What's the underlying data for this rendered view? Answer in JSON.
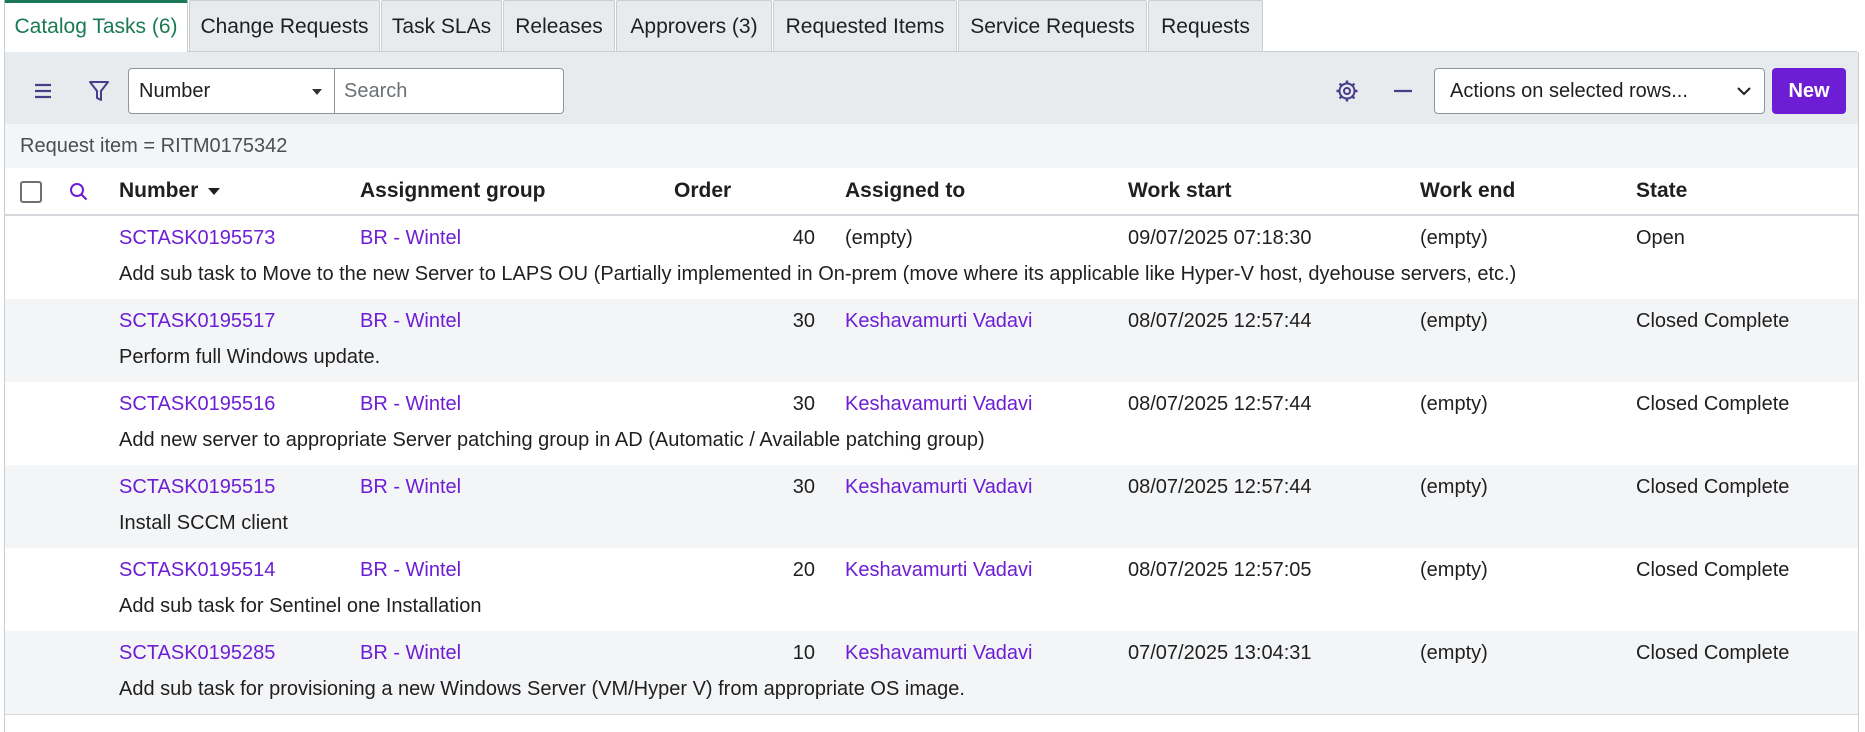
{
  "tabs": [
    {
      "label": "Catalog Tasks (6)",
      "active": true
    },
    {
      "label": "Change Requests"
    },
    {
      "label": "Task SLAs"
    },
    {
      "label": "Releases"
    },
    {
      "label": "Approvers (3)"
    },
    {
      "label": "Requested Items"
    },
    {
      "label": "Service Requests"
    },
    {
      "label": "Requests"
    }
  ],
  "toolbar": {
    "menu_icon": "hamburger-icon",
    "filter_icon": "funnel-icon",
    "field_select": "Number",
    "search_placeholder": "Search",
    "gear_icon": "gear-icon",
    "collapse_icon": "minus-icon",
    "actions_select": "Actions on selected rows...",
    "new_label": "New"
  },
  "filter_text": "Request item = RITM0175342",
  "columns": {
    "number": "Number",
    "assignment_group": "Assignment group",
    "order": "Order",
    "assigned_to": "Assigned to",
    "work_start": "Work start",
    "work_end": "Work end",
    "state": "State"
  },
  "rows": [
    {
      "number": "SCTASK0195573",
      "group": "BR - Wintel",
      "order": "40",
      "assigned_to": "(empty)",
      "assigned_link": false,
      "work_start": "09/07/2025 07:18:30",
      "work_end": "(empty)",
      "state": "Open",
      "description": "Add sub task to Move to the new Server to LAPS OU (Partially implemented in On-prem (move where its applicable like Hyper-V host, dyehouse servers, etc.)"
    },
    {
      "number": "SCTASK0195517",
      "group": "BR - Wintel",
      "order": "30",
      "assigned_to": "Keshavamurti Vadavi",
      "assigned_link": true,
      "work_start": "08/07/2025 12:57:44",
      "work_end": "(empty)",
      "state": "Closed Complete",
      "description": "Perform full Windows update."
    },
    {
      "number": "SCTASK0195516",
      "group": "BR - Wintel",
      "order": "30",
      "assigned_to": "Keshavamurti Vadavi",
      "assigned_link": true,
      "work_start": "08/07/2025 12:57:44",
      "work_end": "(empty)",
      "state": "Closed Complete",
      "description": "Add new server to appropriate Server patching group in AD (Automatic / Available patching group)"
    },
    {
      "number": "SCTASK0195515",
      "group": "BR - Wintel",
      "order": "30",
      "assigned_to": "Keshavamurti Vadavi",
      "assigned_link": true,
      "work_start": "08/07/2025 12:57:44",
      "work_end": "(empty)",
      "state": "Closed Complete",
      "description": "Install SCCM client"
    },
    {
      "number": "SCTASK0195514",
      "group": "BR - Wintel",
      "order": "20",
      "assigned_to": "Keshavamurti Vadavi",
      "assigned_link": true,
      "work_start": "08/07/2025 12:57:05",
      "work_end": "(empty)",
      "state": "Closed Complete",
      "description": "Add sub task for Sentinel one Installation"
    },
    {
      "number": "SCTASK0195285",
      "group": "BR - Wintel",
      "order": "10",
      "assigned_to": "Keshavamurti Vadavi",
      "assigned_link": true,
      "work_start": "07/07/2025 13:04:31",
      "work_end": "(empty)",
      "state": "Closed Complete",
      "description": "Add sub task for provisioning a new Windows Server (VM/Hyper V) from appropriate OS image."
    }
  ],
  "colors": {
    "accent": "#1b7a55",
    "link": "#6d1ed4",
    "primary_button": "#6d1ed4"
  }
}
